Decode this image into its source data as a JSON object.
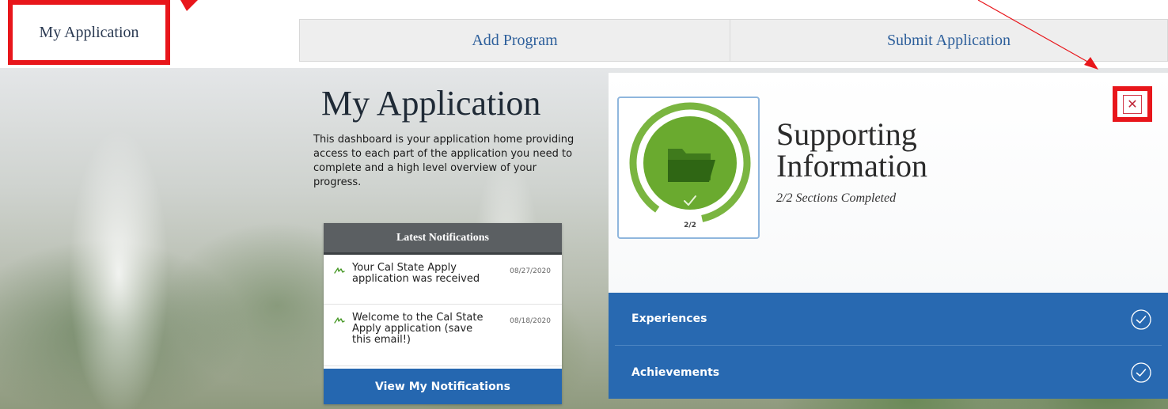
{
  "nav": {
    "my_application": "My Application",
    "add_program": "Add Program",
    "submit_application": "Submit Application"
  },
  "dashboard": {
    "title": "My Application",
    "description": "This dashboard is your application home providing access to each part of the application you need to complete and a high level overview of your progress."
  },
  "notifications": {
    "header": "Latest Notifications",
    "items": [
      {
        "text": "Your Cal State Apply application was received",
        "date": "08/27/2020",
        "icon": "hand-icon"
      },
      {
        "text": "Welcome to the Cal State Apply application (save this email!)",
        "date": "08/18/2020",
        "icon": "hand-icon"
      }
    ],
    "button_label": "View My Notifications"
  },
  "section": {
    "title_line1": "Supporting",
    "title_line2": "Information",
    "subtitle": "2/2 Sections Completed",
    "progress_label": "2/2",
    "progress_fraction": 1.0,
    "icon": "folder-icon",
    "close_symbol": "✕",
    "items": [
      {
        "label": "Experiences",
        "status_icon": "check-circle-icon"
      },
      {
        "label": "Achievements",
        "status_icon": "check-circle-icon"
      }
    ]
  },
  "colors": {
    "annotation_red": "#e8161b",
    "nav_tab_text": "#2d5f9b",
    "section_blue": "#2869b1",
    "badge_green": "#6aaa2f",
    "badge_ring_green": "#7ab540",
    "notif_header": "#5b5f62"
  }
}
